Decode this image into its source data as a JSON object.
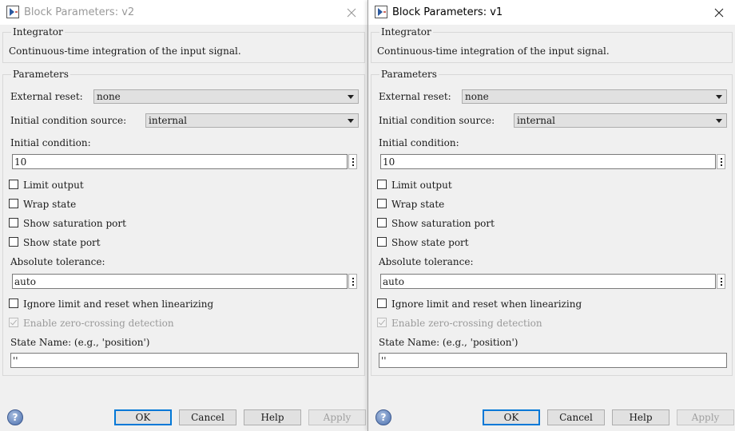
{
  "dialogs": {
    "left": {
      "title": "Block Parameters: v2",
      "block_type": "Integrator",
      "description": "Continuous-time integration of the input signal.",
      "parameters_label": "Parameters",
      "external_reset": {
        "label": "External reset:",
        "value": "none"
      },
      "ic_source": {
        "label": "Initial condition source:",
        "value": "internal"
      },
      "initial_condition": {
        "label": "Initial condition:",
        "value": "10"
      },
      "limit_output": {
        "label": "Limit output",
        "checked": false
      },
      "wrap_state": {
        "label": "Wrap state",
        "checked": false
      },
      "show_saturation_port": {
        "label": "Show saturation port",
        "checked": false
      },
      "show_state_port": {
        "label": "Show state port",
        "checked": false
      },
      "absolute_tolerance": {
        "label": "Absolute tolerance:",
        "value": "auto"
      },
      "ignore_limit": {
        "label": "Ignore limit and reset when linearizing",
        "checked": false
      },
      "zero_crossing": {
        "label": "Enable zero-crossing detection",
        "checked": true,
        "enabled": false
      },
      "state_name": {
        "label": "State Name: (e.g., 'position')",
        "value": "''"
      },
      "buttons": {
        "ok": "OK",
        "cancel": "Cancel",
        "help": "Help",
        "apply": "Apply"
      },
      "help_icon_glyph": "?"
    },
    "right": {
      "title": "Block Parameters: v1",
      "block_type": "Integrator",
      "description": "Continuous-time integration of the input signal.",
      "parameters_label": "Parameters",
      "external_reset": {
        "label": "External reset:",
        "value": "none"
      },
      "ic_source": {
        "label": "Initial condition source:",
        "value": "internal"
      },
      "initial_condition": {
        "label": "Initial condition:",
        "value": "10"
      },
      "limit_output": {
        "label": "Limit output",
        "checked": false
      },
      "wrap_state": {
        "label": "Wrap state",
        "checked": false
      },
      "show_saturation_port": {
        "label": "Show saturation port",
        "checked": false
      },
      "show_state_port": {
        "label": "Show state port",
        "checked": false
      },
      "absolute_tolerance": {
        "label": "Absolute tolerance:",
        "value": "auto"
      },
      "ignore_limit": {
        "label": "Ignore limit and reset when linearizing",
        "checked": false
      },
      "zero_crossing": {
        "label": "Enable zero-crossing detection",
        "checked": true,
        "enabled": false
      },
      "state_name": {
        "label": "State Name: (e.g., 'position')",
        "value": "''"
      },
      "buttons": {
        "ok": "OK",
        "cancel": "Cancel",
        "help": "Help",
        "apply": "Apply"
      },
      "help_icon_glyph": "?"
    }
  },
  "colors": {
    "dialog_bg": "#f0f0f0",
    "titlebar_bg": "#ffffff",
    "default_button_border": "#0078d7",
    "inactive_title_text": "#999999",
    "help_icon_blue": "#4b6fae"
  },
  "icons": {
    "title": "simulink-block-icon",
    "close": "close-icon",
    "help": "help-icon",
    "dropdown": "chevron-down-icon",
    "more": "vertical-ellipsis-icon"
  }
}
